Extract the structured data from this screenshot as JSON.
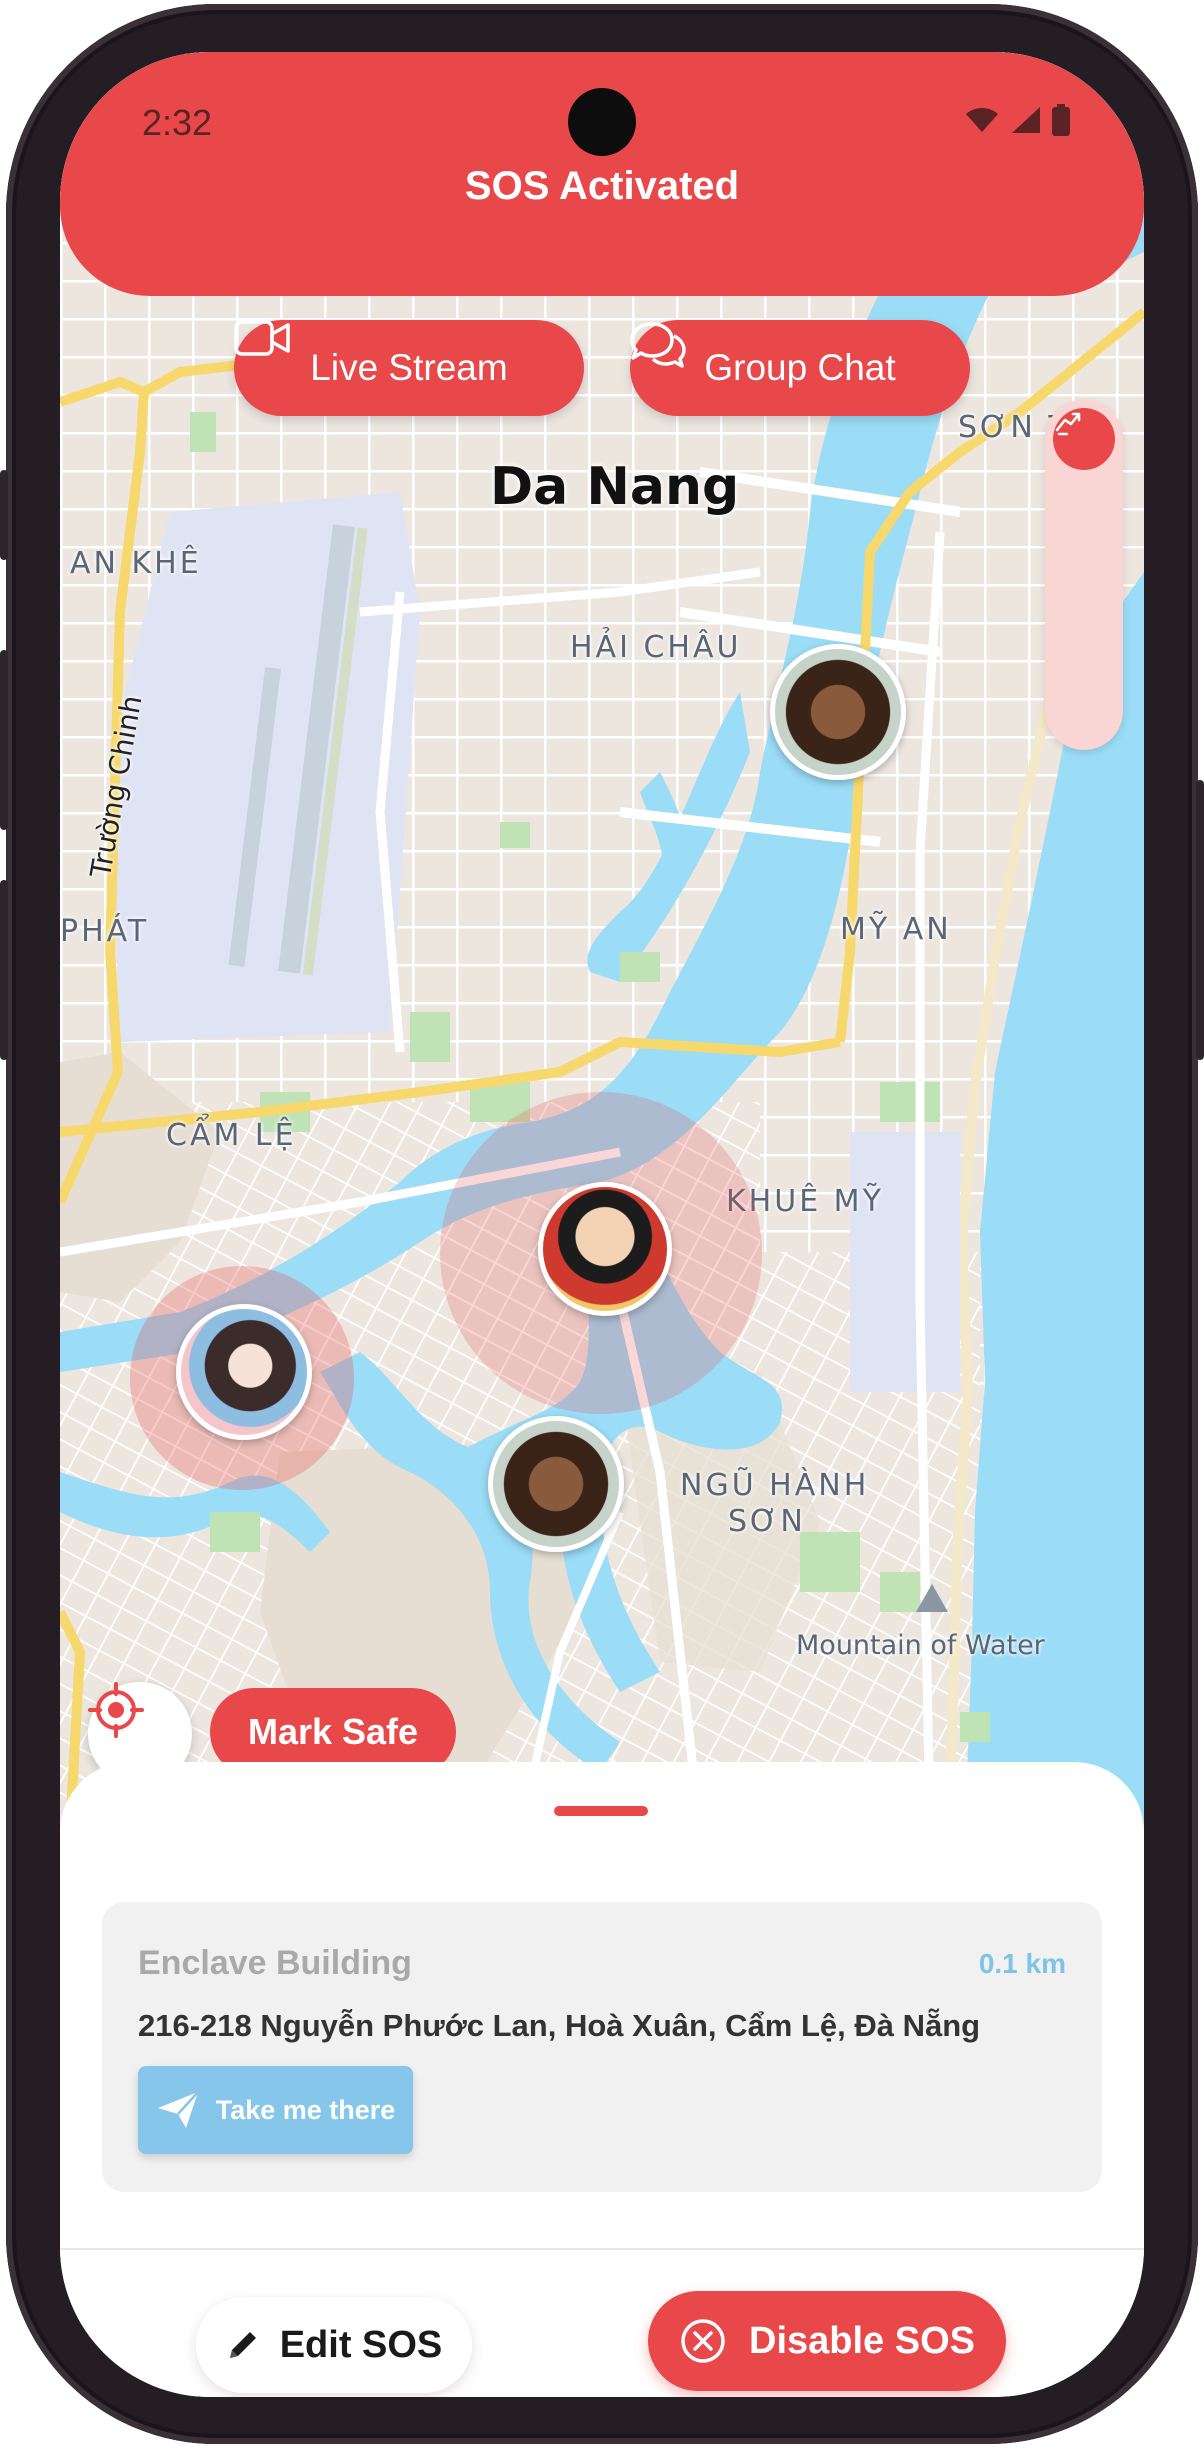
{
  "status_bar": {
    "time": "2:32"
  },
  "header": {
    "title": "SOS Activated"
  },
  "top_actions": {
    "live_stream_label": "Live Stream",
    "group_chat_label": "Group Chat"
  },
  "map": {
    "city_label": "Da Nang",
    "labels": {
      "an_khe": "AN KHÊ",
      "hai_chau": "HẢI CHÂU",
      "son_tra": "SƠN T",
      "truong_chinh": "Trường Chinh",
      "phat": "PHÁT",
      "my_an": "MỸ AN",
      "cam_le": "CẨM LỆ",
      "khue_my": "KHUÊ MỸ",
      "ngu_hanh_son_1": "NGŨ HÀNH",
      "ngu_hanh_son_2": "SƠN",
      "mountain": "Mountain of Water"
    }
  },
  "map_controls": {
    "locate_icon": "locate-target-icon",
    "mark_safe_label": "Mark Safe"
  },
  "destination": {
    "name": "Enclave Building",
    "distance": "0.1 km",
    "address": "216-218 Nguyễn Phước Lan, Hoà Xuân, Cẩm Lệ, Đà Nẵng",
    "take_me_label": "Take me there"
  },
  "footer": {
    "edit_label": "Edit SOS",
    "disable_label": "Disable SOS"
  },
  "colors": {
    "accent": "#e84849",
    "accent_light": "#f9d5d3",
    "info_blue": "#85c6ea",
    "water": "#9bdcf6"
  }
}
